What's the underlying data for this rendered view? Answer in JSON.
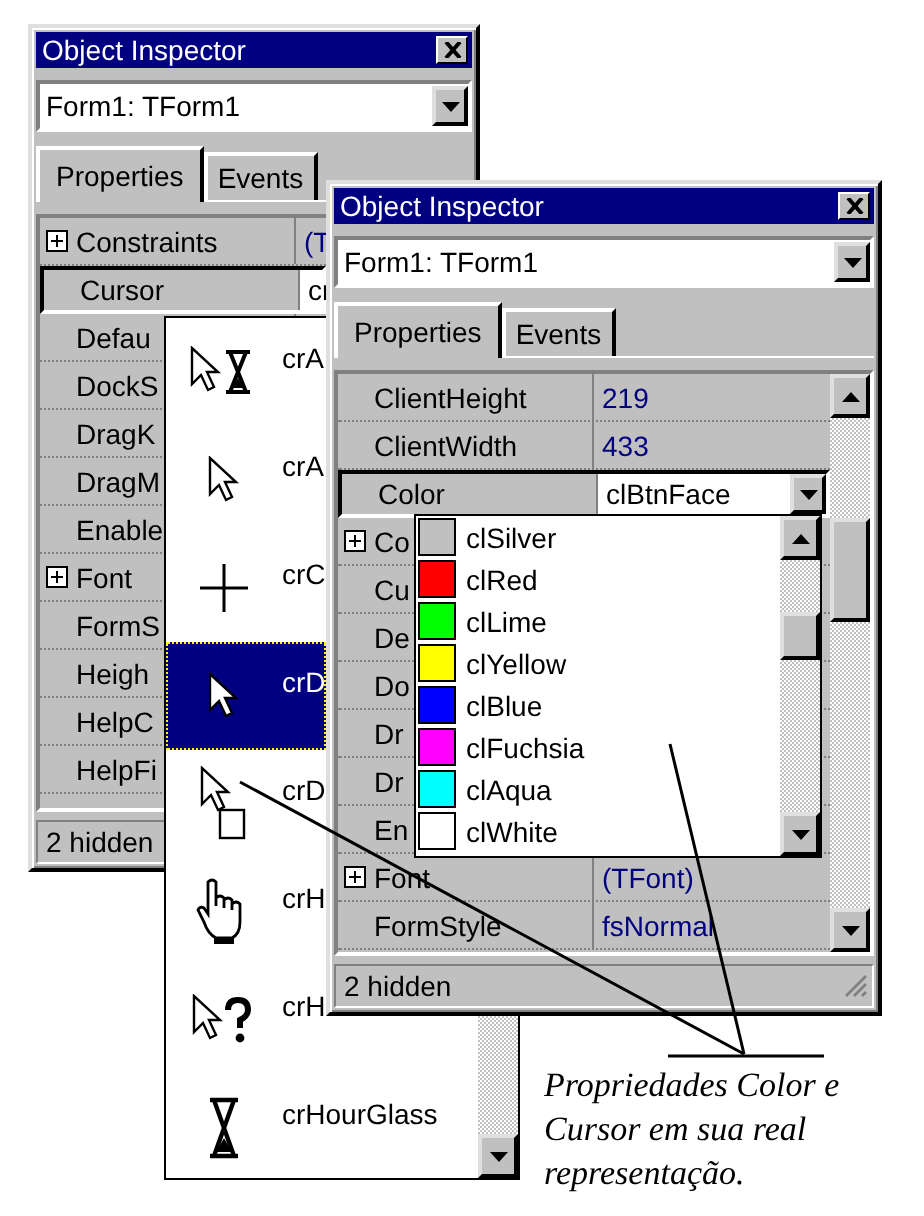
{
  "inspectors": [
    {
      "title": "Object Inspector",
      "object": "Form1: TForm1",
      "tabs": [
        {
          "label": "Properties",
          "selected": true
        },
        {
          "label": "Events",
          "selected": false
        }
      ],
      "properties": [
        {
          "name": "Constraints",
          "value": "(T",
          "expandable": true,
          "selected": false
        },
        {
          "name": "Cursor",
          "value": "cr",
          "expandable": false,
          "selected": true
        },
        {
          "name": "Defau",
          "expandable": false,
          "selected": false
        },
        {
          "name": "DockS",
          "expandable": false,
          "selected": false
        },
        {
          "name": "DragK",
          "expandable": false,
          "selected": false
        },
        {
          "name": "DragM",
          "expandable": false,
          "selected": false
        },
        {
          "name": "Enable",
          "expandable": false,
          "selected": false
        },
        {
          "name": "Font",
          "expandable": true,
          "selected": false
        },
        {
          "name": "FormS",
          "expandable": false,
          "selected": false
        },
        {
          "name": "Heigh",
          "expandable": false,
          "selected": false
        },
        {
          "name": "HelpC",
          "expandable": false,
          "selected": false
        },
        {
          "name": "HelpFi",
          "expandable": false,
          "selected": false
        }
      ],
      "status": "2 hidden"
    },
    {
      "title": "Object Inspector",
      "object": "Form1: TForm1",
      "tabs": [
        {
          "label": "Properties",
          "selected": true
        },
        {
          "label": "Events",
          "selected": false
        }
      ],
      "properties": [
        {
          "name": "ClientHeight",
          "value": "219",
          "expandable": false,
          "selected": false
        },
        {
          "name": "ClientWidth",
          "value": "433",
          "expandable": false,
          "selected": false
        },
        {
          "name": "Color",
          "value": "clBtnFace",
          "expandable": false,
          "selected": true
        },
        {
          "name": "Co",
          "expandable": true,
          "selected": false
        },
        {
          "name": "Cu",
          "expandable": false,
          "selected": false
        },
        {
          "name": "De",
          "expandable": false,
          "selected": false
        },
        {
          "name": "Do",
          "expandable": false,
          "selected": false
        },
        {
          "name": "Dr",
          "expandable": false,
          "selected": false
        },
        {
          "name": "Dr",
          "expandable": false,
          "selected": false
        },
        {
          "name": "En",
          "expandable": false,
          "selected": false
        },
        {
          "name": "Font",
          "value": "(TFont)",
          "expandable": true,
          "selected": false
        },
        {
          "name": "FormStyle",
          "value": "fsNormal",
          "expandable": false,
          "selected": false
        }
      ],
      "status": "2 hidden"
    }
  ],
  "cursor_list": [
    {
      "label": "crA",
      "kind": "appstart",
      "selected": false
    },
    {
      "label": "crA",
      "kind": "arrow",
      "selected": false
    },
    {
      "label": "crC",
      "kind": "cross",
      "selected": false
    },
    {
      "label": "crD",
      "kind": "default",
      "selected": true
    },
    {
      "label": "crD",
      "kind": "drag",
      "selected": false
    },
    {
      "label": "crH",
      "kind": "hand",
      "selected": false
    },
    {
      "label": "crH",
      "kind": "help",
      "selected": false
    },
    {
      "label": "crHourGlass",
      "kind": "hourglass",
      "selected": false
    }
  ],
  "color_list": [
    {
      "label": "clSilver",
      "color": "#c0c0c0"
    },
    {
      "label": "clRed",
      "color": "#ff0000"
    },
    {
      "label": "clLime",
      "color": "#00ff00"
    },
    {
      "label": "clYellow",
      "color": "#ffff00"
    },
    {
      "label": "clBlue",
      "color": "#0000ff"
    },
    {
      "label": "clFuchsia",
      "color": "#ff00ff"
    },
    {
      "label": "clAqua",
      "color": "#00ffff"
    },
    {
      "label": "clWhite",
      "color": "#ffffff"
    }
  ],
  "caption": "Propriedades Color e Cursor em sua real representação."
}
